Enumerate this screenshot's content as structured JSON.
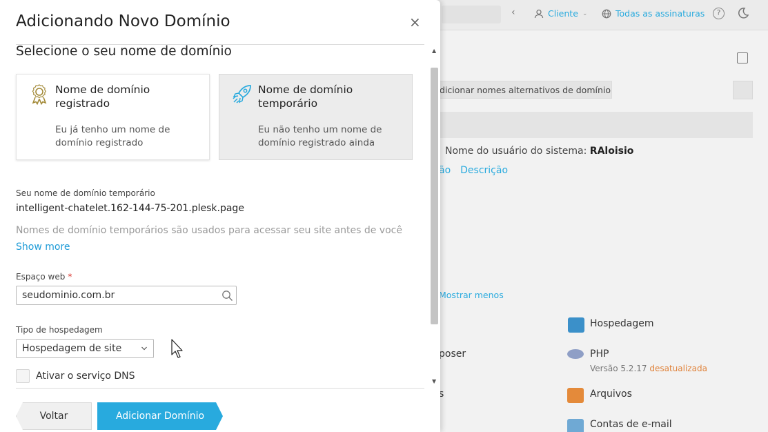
{
  "background": {
    "user_label": "Cliente",
    "subscriptions_label": "Todas as assinaturas",
    "help_glyph": "?",
    "alias_button_label": "dicionar nomes alternativos de domínio",
    "system_user_prefix": "Nome do usuário do sistema:",
    "system_user_name": "RAloisio",
    "links": [
      "ão",
      "Descrição"
    ],
    "show_less": "Mostrar menos",
    "tiles": {
      "hosting": "Hospedagem",
      "composer": "poser",
      "php": "PHP",
      "php_version": "Versão 5.2.17",
      "php_status": "desatualizada",
      "files_left": "s",
      "files": "Arquivos",
      "email": "Contas de e-mail"
    }
  },
  "modal": {
    "title": "Adicionando Novo Domínio",
    "section_title": "Selecione o seu nome de domínio",
    "cards": [
      {
        "title": "Nome de domínio registrado",
        "description": "Eu já tenho um nome de domínio registrado",
        "icon": "award-icon",
        "selected": false
      },
      {
        "title": "Nome de domínio temporário",
        "description": "Eu não tenho um nome de domínio registrado ainda",
        "icon": "rocket-icon",
        "selected": true
      }
    ],
    "temp_label": "Seu nome de domínio temporário",
    "temp_value": "intelligent-chatelet.162-144-75-201.plesk.page",
    "note": "Nomes de domínio temporários são usados para acessar seu site antes de você se",
    "show_more": "Show more",
    "webspace_label": "Espaço web",
    "required_mark": "*",
    "webspace_value": "seudominio.com.br",
    "hosting_type_label": "Tipo de hospedagem",
    "hosting_type_value": "Hospedagem de site",
    "dns_label": "Ativar o serviço DNS",
    "back_button": "Voltar",
    "add_button": "Adicionar Domínio"
  },
  "colors": {
    "accent": "#28aade",
    "link": "#1e9bd7",
    "required": "#d9322a",
    "warning": "#e0823a",
    "award_icon": "#a38a38"
  }
}
